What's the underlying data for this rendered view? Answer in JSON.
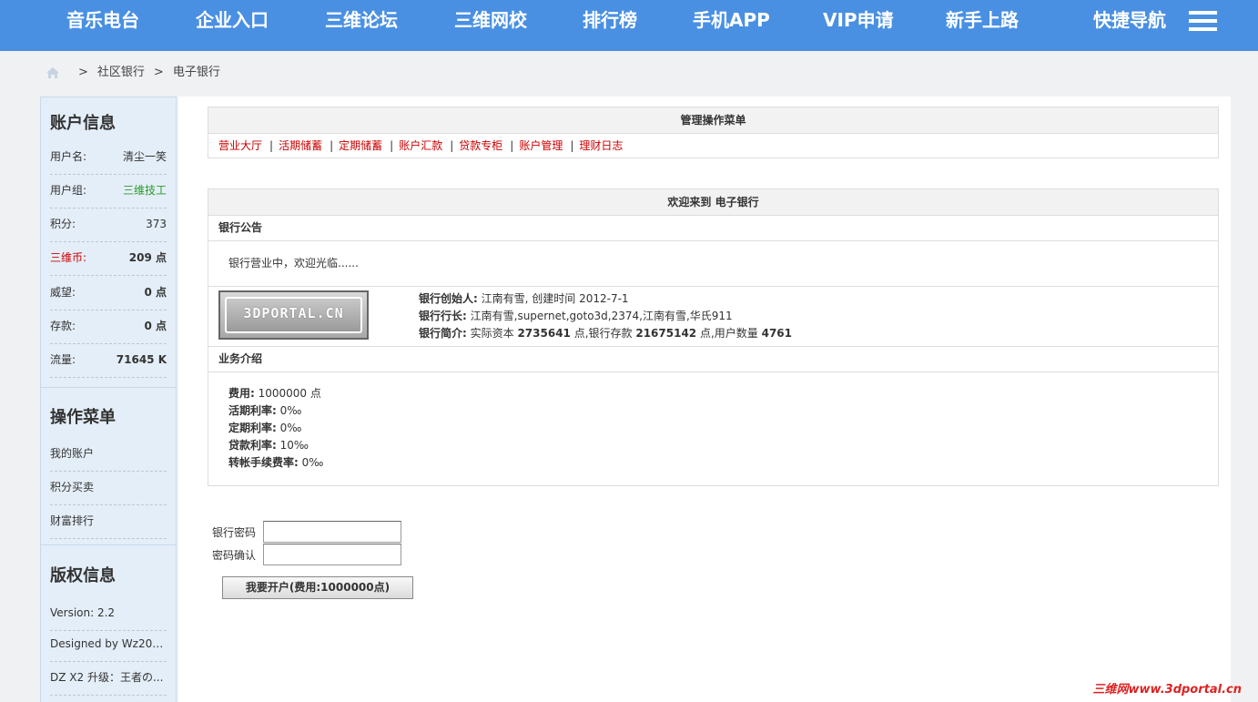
{
  "nav": {
    "items": [
      "音乐电台",
      "企业入口",
      "三维论坛",
      "三维网校",
      "排行榜",
      "手机APP",
      "VIP申请",
      "新手上路",
      "快捷导航"
    ],
    "menu_icon": "list-menu-icon"
  },
  "breadcrumb": {
    "home_icon": "home-icon",
    "sep": ">",
    "items": [
      "社区银行",
      "电子银行"
    ]
  },
  "sidebar": {
    "account": {
      "title": "账户信息",
      "rows": [
        {
          "label": "用户名:",
          "value": "清尘一笑"
        },
        {
          "label": "用户组:",
          "value": "三维技工"
        },
        {
          "label": "积分:",
          "value": "373"
        },
        {
          "label": "三维币:",
          "value": "209 点"
        },
        {
          "label": "威望:",
          "value": "0 点"
        },
        {
          "label": "存款:",
          "value": "0 点"
        },
        {
          "label": "流量:",
          "value": "71645 K"
        }
      ]
    },
    "ops": {
      "title": "操作菜单",
      "items": [
        "我的账户",
        "积分买卖",
        "财富排行"
      ]
    },
    "copyright": {
      "title": "版权信息",
      "items": [
        "Version: 2.2",
        "Designed by Wz200...",
        "DZ X2 升级：王者の..."
      ]
    }
  },
  "menu_box": {
    "title": "管理操作菜单",
    "links": [
      "营业大厅",
      "活期储蓄",
      "定期储蓄",
      "账户汇款",
      "贷款专柜",
      "账户管理",
      "理财日志"
    ],
    "pipe": "|"
  },
  "bank_box": {
    "title": "欢迎来到 电子银行",
    "notice_title": "银行公告",
    "notice_text": "银行营业中，欢迎光临......",
    "logo_text": "3DPORTAL.CN",
    "founder_label": "银行创始人:",
    "founder_value": " 江南有雪, 创建时间 2012-7-1",
    "president_label": "银行行长:",
    "president_value": " 江南有雪,supernet,goto3d,2374,江南有雪,华氏911",
    "intro_label": "银行简介:",
    "intro_p1": " 实际资本 ",
    "capital": "2735641",
    "intro_p2": " 点,银行存款 ",
    "deposits": "21675142",
    "intro_p3": " 点,用户数量 ",
    "users": "4761",
    "biz_title": "业务介绍",
    "fees": [
      {
        "label": "费用:",
        "value": " 1000000 点"
      },
      {
        "label": "活期利率:",
        "value": " 0‰"
      },
      {
        "label": "定期利率:",
        "value": " 0‰"
      },
      {
        "label": "贷款利率:",
        "value": " 10‰"
      },
      {
        "label": "转帐手续费率:",
        "value": " 0‰"
      }
    ]
  },
  "form": {
    "password_label": "银行密码",
    "password_value": "",
    "confirm_label": "密码确认",
    "confirm_value": "",
    "submit_label": "我要开户(费用:1000000点)"
  },
  "watermark": "三维网www.3dportal.cn",
  "colors": {
    "nav_bg": "#4a90e2",
    "link_red": "#cc0000",
    "group_green": "#2a9a2a",
    "coin_red": "#cc0000"
  }
}
